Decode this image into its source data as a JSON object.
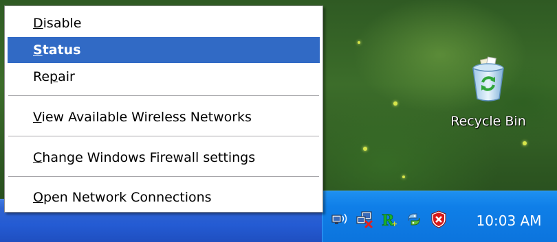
{
  "context_menu": {
    "items": [
      {
        "label": "Disable",
        "accel_before": "",
        "accel": "D",
        "accel_after": "isable",
        "highlighted": false
      },
      {
        "label": "Status",
        "accel_before": "",
        "accel": "S",
        "accel_after": "tatus",
        "highlighted": true
      },
      {
        "label": "Repair",
        "accel_before": "Re",
        "accel": "p",
        "accel_after": "air",
        "highlighted": false
      },
      {
        "label": "View Available Wireless Networks",
        "accel_before": "",
        "accel": "V",
        "accel_after": "iew Available Wireless Networks",
        "highlighted": false
      },
      {
        "label": "Change Windows Firewall settings",
        "accel_before": "",
        "accel": "C",
        "accel_after": "hange Windows Firewall settings",
        "highlighted": false
      },
      {
        "label": "Open Network Connections",
        "accel_before": "",
        "accel": "O",
        "accel_after": "pen Network Connections",
        "highlighted": false
      }
    ]
  },
  "desktop": {
    "recycle_bin_label": "Recycle Bin"
  },
  "taskbar": {
    "clock": "10:03 AM",
    "tray_icons": [
      "wireless-network-icon",
      "network-disconnected-icon",
      "r-app-icon",
      "python-icon",
      "security-center-shield-icon"
    ]
  },
  "colors": {
    "menu_highlight": "#316ac5",
    "taskbar_blue": "#245bd3",
    "tray_blue": "#0f7fe8"
  }
}
